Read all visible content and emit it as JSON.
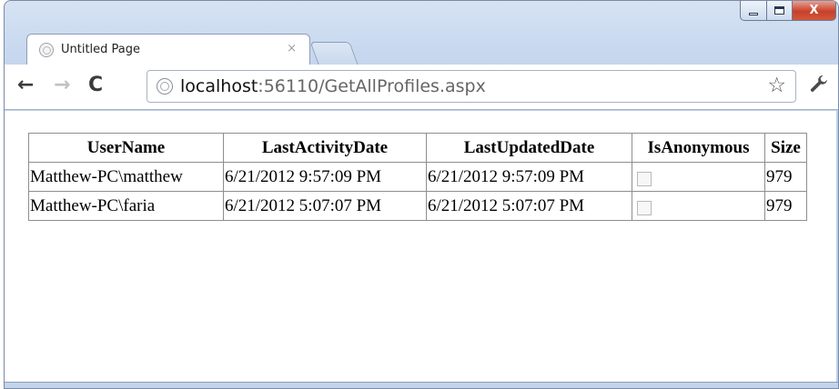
{
  "browser": {
    "tab_title": "Untitled Page",
    "tab_close": "×",
    "url_host": "localhost",
    "url_rest": ":56110/GetAllProfiles.aspx",
    "icons": {
      "back": "←",
      "forward": "→",
      "reload": "C",
      "star": "☆",
      "wrench": "🔧",
      "close": "X"
    }
  },
  "table": {
    "headers": [
      "UserName",
      "LastActivityDate",
      "LastUpdatedDate",
      "IsAnonymous",
      "Size"
    ],
    "rows": [
      {
        "username": "Matthew-PC\\matthew",
        "last_activity": "6/21/2012 9:57:09 PM",
        "last_updated": "6/21/2012 9:57:09 PM",
        "is_anonymous": false,
        "size": "979"
      },
      {
        "username": "Matthew-PC\\faria",
        "last_activity": "6/21/2012 5:07:07 PM",
        "last_updated": "6/21/2012 5:07:07 PM",
        "is_anonymous": false,
        "size": "979"
      }
    ]
  }
}
